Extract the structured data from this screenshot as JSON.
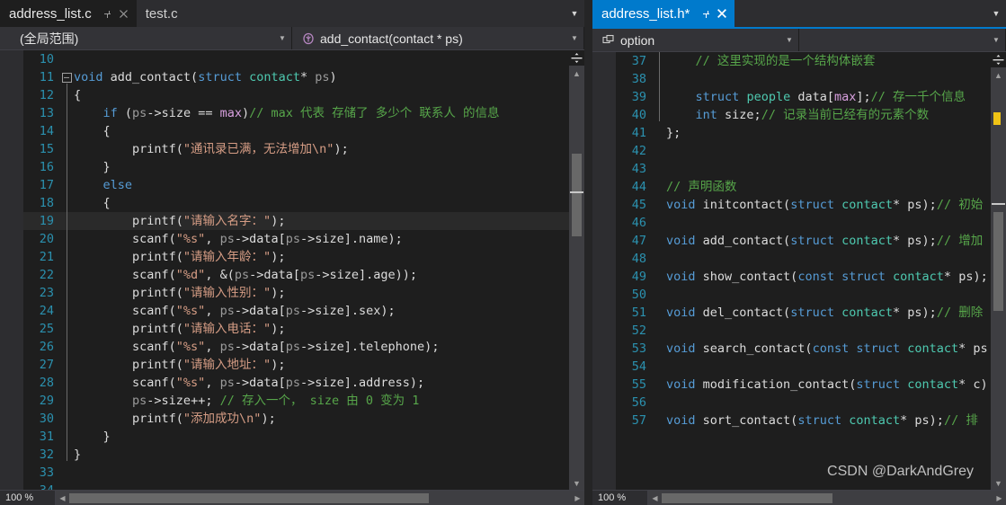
{
  "colors": {
    "accent": "#007acc",
    "editor_bg": "#1e1e1e",
    "chrome_bg": "#2d2d30",
    "line_number": "#2b91af",
    "keyword": "#569cd6",
    "type": "#4ec9b0",
    "macro": "#d8a0df",
    "string": "#d69d85",
    "comment": "#57a64a",
    "plain": "#dcdcdc",
    "param": "#9b9b9b",
    "unsaved_marker": "#f0c416"
  },
  "watermark": "CSDN @DarkAndGrey",
  "left_pane": {
    "tabs": [
      {
        "label": "address_list.c",
        "state": "active",
        "pin_icon": "pin-icon",
        "close_icon": "close-icon"
      },
      {
        "label": "test.c",
        "state": "inactive"
      }
    ],
    "tab_dropdown_icon": "chevron-down-icon",
    "navbar": {
      "scope": {
        "text": "(全局范围)",
        "caret_icon": "chevron-down-icon"
      },
      "member": {
        "text": "add_contact(contact * ps)",
        "icon": "method-icon",
        "caret_icon": "chevron-down-icon"
      }
    },
    "zoom_level": "100 %",
    "scroll_left_icon": "triangle-left-icon",
    "scroll_right_icon": "triangle-right-icon",
    "vscroll": {
      "split_icon": "split-pane-icon",
      "up_icon": "triangle-up-icon",
      "down_icon": "triangle-down-icon"
    },
    "code": [
      {
        "num": "10",
        "fold": "",
        "guide": false,
        "tokens": []
      },
      {
        "num": "11",
        "fold": "minus",
        "guide": false,
        "tokens": [
          {
            "t": "void ",
            "c": "k"
          },
          {
            "t": "add_contact",
            "c": "pl"
          },
          {
            "t": "(",
            "c": "pl"
          },
          {
            "t": "struct",
            "c": "k"
          },
          {
            "t": " ",
            "c": "pl"
          },
          {
            "t": "contact",
            "c": "ty"
          },
          {
            "t": "* ",
            "c": "pl"
          },
          {
            "t": "ps",
            "c": "va"
          },
          {
            "t": ")",
            "c": "pl"
          }
        ]
      },
      {
        "num": "12",
        "fold": "",
        "guide": true,
        "tokens": [
          {
            "t": "{",
            "c": "pl"
          }
        ]
      },
      {
        "num": "13",
        "fold": "",
        "guide": true,
        "tokens": [
          {
            "t": "    ",
            "c": "pl"
          },
          {
            "t": "if",
            "c": "k"
          },
          {
            "t": " (",
            "c": "pl"
          },
          {
            "t": "ps",
            "c": "va"
          },
          {
            "t": "->size == ",
            "c": "pl"
          },
          {
            "t": "max",
            "c": "mc"
          },
          {
            "t": ")",
            "c": "pl"
          },
          {
            "t": "// max 代表 存储了 多少个 联系人 的信息",
            "c": "cm"
          }
        ]
      },
      {
        "num": "14",
        "fold": "",
        "guide": true,
        "tokens": [
          {
            "t": "    {",
            "c": "pl"
          }
        ]
      },
      {
        "num": "15",
        "fold": "",
        "guide": true,
        "tokens": [
          {
            "t": "        printf(",
            "c": "pl"
          },
          {
            "t": "\"通讯录已满，无法增加\\n\"",
            "c": "st"
          },
          {
            "t": ");",
            "c": "pl"
          }
        ]
      },
      {
        "num": "16",
        "fold": "",
        "guide": true,
        "tokens": [
          {
            "t": "    }",
            "c": "pl"
          }
        ]
      },
      {
        "num": "17",
        "fold": "",
        "guide": true,
        "tokens": [
          {
            "t": "    ",
            "c": "pl"
          },
          {
            "t": "else",
            "c": "k"
          }
        ]
      },
      {
        "num": "18",
        "fold": "",
        "guide": true,
        "tokens": [
          {
            "t": "    {",
            "c": "pl"
          }
        ]
      },
      {
        "num": "19",
        "fold": "",
        "guide": true,
        "highlight": true,
        "tokens": [
          {
            "t": "        printf(",
            "c": "pl"
          },
          {
            "t": "\"请输入名字：\"",
            "c": "st"
          },
          {
            "t": ");",
            "c": "pl"
          }
        ]
      },
      {
        "num": "20",
        "fold": "",
        "guide": true,
        "tokens": [
          {
            "t": "        scanf(",
            "c": "pl"
          },
          {
            "t": "\"%s\"",
            "c": "st"
          },
          {
            "t": ", ",
            "c": "pl"
          },
          {
            "t": "ps",
            "c": "va"
          },
          {
            "t": "->data[",
            "c": "pl"
          },
          {
            "t": "ps",
            "c": "va"
          },
          {
            "t": "->size].name);",
            "c": "pl"
          }
        ]
      },
      {
        "num": "21",
        "fold": "",
        "guide": true,
        "tokens": [
          {
            "t": "        printf(",
            "c": "pl"
          },
          {
            "t": "\"请输入年龄：\"",
            "c": "st"
          },
          {
            "t": ");",
            "c": "pl"
          }
        ]
      },
      {
        "num": "22",
        "fold": "",
        "guide": true,
        "tokens": [
          {
            "t": "        scanf(",
            "c": "pl"
          },
          {
            "t": "\"%d\"",
            "c": "st"
          },
          {
            "t": ", &(",
            "c": "pl"
          },
          {
            "t": "ps",
            "c": "va"
          },
          {
            "t": "->data[",
            "c": "pl"
          },
          {
            "t": "ps",
            "c": "va"
          },
          {
            "t": "->size].age));",
            "c": "pl"
          }
        ]
      },
      {
        "num": "23",
        "fold": "",
        "guide": true,
        "tokens": [
          {
            "t": "        printf(",
            "c": "pl"
          },
          {
            "t": "\"请输入性别：\"",
            "c": "st"
          },
          {
            "t": ");",
            "c": "pl"
          }
        ]
      },
      {
        "num": "24",
        "fold": "",
        "guide": true,
        "tokens": [
          {
            "t": "        scanf(",
            "c": "pl"
          },
          {
            "t": "\"%s\"",
            "c": "st"
          },
          {
            "t": ", ",
            "c": "pl"
          },
          {
            "t": "ps",
            "c": "va"
          },
          {
            "t": "->data[",
            "c": "pl"
          },
          {
            "t": "ps",
            "c": "va"
          },
          {
            "t": "->size].sex);",
            "c": "pl"
          }
        ]
      },
      {
        "num": "25",
        "fold": "",
        "guide": true,
        "tokens": [
          {
            "t": "        printf(",
            "c": "pl"
          },
          {
            "t": "\"请输入电话：\"",
            "c": "st"
          },
          {
            "t": ");",
            "c": "pl"
          }
        ]
      },
      {
        "num": "26",
        "fold": "",
        "guide": true,
        "tokens": [
          {
            "t": "        scanf(",
            "c": "pl"
          },
          {
            "t": "\"%s\"",
            "c": "st"
          },
          {
            "t": ", ",
            "c": "pl"
          },
          {
            "t": "ps",
            "c": "va"
          },
          {
            "t": "->data[",
            "c": "pl"
          },
          {
            "t": "ps",
            "c": "va"
          },
          {
            "t": "->size].telephone);",
            "c": "pl"
          }
        ]
      },
      {
        "num": "27",
        "fold": "",
        "guide": true,
        "tokens": [
          {
            "t": "        printf(",
            "c": "pl"
          },
          {
            "t": "\"请输入地址：\"",
            "c": "st"
          },
          {
            "t": ");",
            "c": "pl"
          }
        ]
      },
      {
        "num": "28",
        "fold": "",
        "guide": true,
        "tokens": [
          {
            "t": "        scanf(",
            "c": "pl"
          },
          {
            "t": "\"%s\"",
            "c": "st"
          },
          {
            "t": ", ",
            "c": "pl"
          },
          {
            "t": "ps",
            "c": "va"
          },
          {
            "t": "->data[",
            "c": "pl"
          },
          {
            "t": "ps",
            "c": "va"
          },
          {
            "t": "->size].address);",
            "c": "pl"
          }
        ]
      },
      {
        "num": "29",
        "fold": "",
        "guide": true,
        "tokens": [
          {
            "t": "        ",
            "c": "pl"
          },
          {
            "t": "ps",
            "c": "va"
          },
          {
            "t": "->size++; ",
            "c": "pl"
          },
          {
            "t": "// 存入一个， size 由 0 变为 1",
            "c": "cm"
          }
        ]
      },
      {
        "num": "30",
        "fold": "",
        "guide": true,
        "tokens": [
          {
            "t": "        printf(",
            "c": "pl"
          },
          {
            "t": "\"添加成功\\n\"",
            "c": "st"
          },
          {
            "t": ");",
            "c": "pl"
          }
        ]
      },
      {
        "num": "31",
        "fold": "",
        "guide": true,
        "tokens": [
          {
            "t": "    }",
            "c": "pl"
          }
        ]
      },
      {
        "num": "32",
        "fold": "",
        "guide": true,
        "tokens": [
          {
            "t": "}",
            "c": "pl"
          }
        ]
      },
      {
        "num": "33",
        "fold": "",
        "guide": false,
        "tokens": []
      },
      {
        "num": "34",
        "fold": "",
        "guide": false,
        "tokens": []
      }
    ]
  },
  "right_pane": {
    "tabs": [
      {
        "label": "address_list.h*",
        "state": "active",
        "pin_icon": "pin-icon",
        "close_icon": "close-icon"
      }
    ],
    "tab_dropdown_icon": "chevron-down-icon",
    "navbar": {
      "scope": {
        "text": "option",
        "icon": "struct-icon",
        "caret_icon": "chevron-down-icon"
      },
      "member": {
        "text": "",
        "caret_icon": "chevron-down-icon"
      }
    },
    "zoom_level": "100 %",
    "scroll_left_icon": "triangle-left-icon",
    "scroll_right_icon": "triangle-right-icon",
    "vscroll": {
      "split_icon": "split-pane-icon",
      "up_icon": "triangle-up-icon",
      "down_icon": "triangle-down-icon"
    },
    "code": [
      {
        "num": "37",
        "guide": true,
        "tokens": [
          {
            "t": "    ",
            "c": "pl"
          },
          {
            "t": "// 这里实现的是一个结构体嵌套",
            "c": "cm"
          }
        ]
      },
      {
        "num": "38",
        "guide": true,
        "tokens": []
      },
      {
        "num": "39",
        "guide": true,
        "tokens": [
          {
            "t": "    ",
            "c": "pl"
          },
          {
            "t": "struct",
            "c": "k"
          },
          {
            "t": " ",
            "c": "pl"
          },
          {
            "t": "people",
            "c": "ty"
          },
          {
            "t": " data[",
            "c": "pl"
          },
          {
            "t": "max",
            "c": "mc"
          },
          {
            "t": "];",
            "c": "pl"
          },
          {
            "t": "// 存一千个信息",
            "c": "cm"
          }
        ]
      },
      {
        "num": "40",
        "guide": true,
        "tokens": [
          {
            "t": "    ",
            "c": "pl"
          },
          {
            "t": "int",
            "c": "k"
          },
          {
            "t": " size;",
            "c": "pl"
          },
          {
            "t": "// 记录当前已经有的元素个数",
            "c": "cm"
          }
        ]
      },
      {
        "num": "41",
        "guide": false,
        "tokens": [
          {
            "t": "};",
            "c": "pl"
          }
        ]
      },
      {
        "num": "42",
        "guide": false,
        "tokens": []
      },
      {
        "num": "43",
        "guide": false,
        "tokens": []
      },
      {
        "num": "44",
        "guide": false,
        "tokens": [
          {
            "t": "// 声明函数",
            "c": "cm"
          }
        ]
      },
      {
        "num": "45",
        "guide": false,
        "tokens": [
          {
            "t": "void",
            "c": "k"
          },
          {
            "t": " initcontact(",
            "c": "pl"
          },
          {
            "t": "struct",
            "c": "k"
          },
          {
            "t": " ",
            "c": "pl"
          },
          {
            "t": "contact",
            "c": "ty"
          },
          {
            "t": "* ",
            "c": "pl"
          },
          {
            "t": "ps",
            "c": "pl"
          },
          {
            "t": ");",
            "c": "pl"
          },
          {
            "t": "// 初始",
            "c": "cm"
          }
        ]
      },
      {
        "num": "46",
        "guide": false,
        "tokens": []
      },
      {
        "num": "47",
        "guide": false,
        "tokens": [
          {
            "t": "void",
            "c": "k"
          },
          {
            "t": " add_contact(",
            "c": "pl"
          },
          {
            "t": "struct",
            "c": "k"
          },
          {
            "t": " ",
            "c": "pl"
          },
          {
            "t": "contact",
            "c": "ty"
          },
          {
            "t": "* ",
            "c": "pl"
          },
          {
            "t": "ps",
            "c": "pl"
          },
          {
            "t": ");",
            "c": "pl"
          },
          {
            "t": "// 增加",
            "c": "cm"
          }
        ]
      },
      {
        "num": "48",
        "guide": false,
        "tokens": []
      },
      {
        "num": "49",
        "guide": false,
        "tokens": [
          {
            "t": "void",
            "c": "k"
          },
          {
            "t": " show_contact(",
            "c": "pl"
          },
          {
            "t": "const",
            "c": "k"
          },
          {
            "t": " ",
            "c": "pl"
          },
          {
            "t": "struct",
            "c": "k"
          },
          {
            "t": " ",
            "c": "pl"
          },
          {
            "t": "contact",
            "c": "ty"
          },
          {
            "t": "* ",
            "c": "pl"
          },
          {
            "t": "ps",
            "c": "pl"
          },
          {
            "t": ");",
            "c": "pl"
          }
        ]
      },
      {
        "num": "50",
        "guide": false,
        "tokens": []
      },
      {
        "num": "51",
        "guide": false,
        "tokens": [
          {
            "t": "void",
            "c": "k"
          },
          {
            "t": " del_contact(",
            "c": "pl"
          },
          {
            "t": "struct",
            "c": "k"
          },
          {
            "t": " ",
            "c": "pl"
          },
          {
            "t": "contact",
            "c": "ty"
          },
          {
            "t": "* ",
            "c": "pl"
          },
          {
            "t": "ps",
            "c": "pl"
          },
          {
            "t": ");",
            "c": "pl"
          },
          {
            "t": "// 删除",
            "c": "cm"
          }
        ]
      },
      {
        "num": "52",
        "guide": false,
        "tokens": []
      },
      {
        "num": "53",
        "guide": false,
        "tokens": [
          {
            "t": "void",
            "c": "k"
          },
          {
            "t": " search_contact(",
            "c": "pl"
          },
          {
            "t": "const",
            "c": "k"
          },
          {
            "t": " ",
            "c": "pl"
          },
          {
            "t": "struct",
            "c": "k"
          },
          {
            "t": " ",
            "c": "pl"
          },
          {
            "t": "contact",
            "c": "ty"
          },
          {
            "t": "* ps",
            "c": "pl"
          }
        ]
      },
      {
        "num": "54",
        "guide": false,
        "tokens": []
      },
      {
        "num": "55",
        "guide": false,
        "tokens": [
          {
            "t": "void",
            "c": "k"
          },
          {
            "t": " modification_contact(",
            "c": "pl"
          },
          {
            "t": "struct",
            "c": "k"
          },
          {
            "t": " ",
            "c": "pl"
          },
          {
            "t": "contact",
            "c": "ty"
          },
          {
            "t": "* c)",
            "c": "pl"
          }
        ]
      },
      {
        "num": "56",
        "guide": false,
        "tokens": []
      },
      {
        "num": "57",
        "guide": false,
        "tokens": [
          {
            "t": "void",
            "c": "k"
          },
          {
            "t": " sort_contact(",
            "c": "pl"
          },
          {
            "t": "struct",
            "c": "k"
          },
          {
            "t": " ",
            "c": "pl"
          },
          {
            "t": "contact",
            "c": "ty"
          },
          {
            "t": "* ",
            "c": "pl"
          },
          {
            "t": "ps",
            "c": "pl"
          },
          {
            "t": ");",
            "c": "pl"
          },
          {
            "t": "// 排",
            "c": "cm"
          }
        ]
      }
    ]
  }
}
